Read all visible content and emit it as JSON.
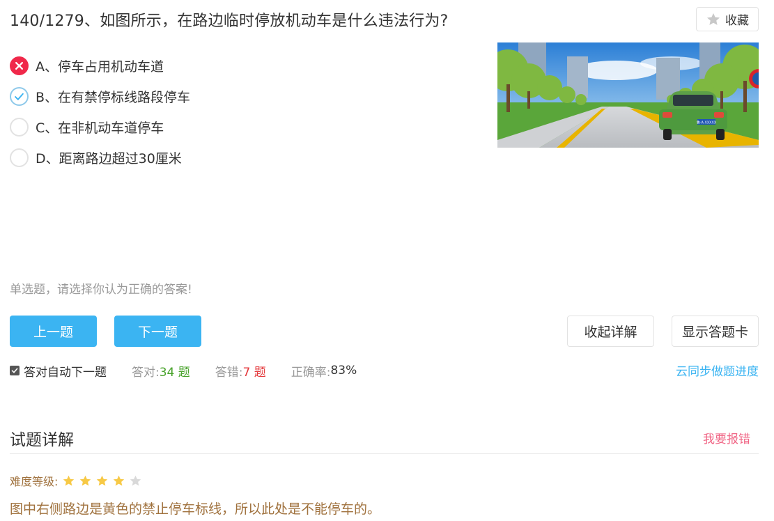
{
  "question": {
    "title": "140/1279、如图所示，在路边临时停放机动车是什么违法行为?",
    "favorite_label": "收藏",
    "favorite_icon": "star-icon"
  },
  "options": [
    {
      "label": "A、停车占用机动车道",
      "state": "wrong"
    },
    {
      "label": "B、在有禁停标线路段停车",
      "state": "correct"
    },
    {
      "label": "C、在非机动车道停车",
      "state": "none"
    },
    {
      "label": "D、距离路边超过30厘米",
      "state": "none"
    }
  ],
  "plate_text": "鲁·A·XXXXX",
  "hint": "单选题，请选择你认为正确的答案!",
  "buttons": {
    "prev": "上一题",
    "next": "下一题",
    "collapse": "收起详解",
    "answer_card": "显示答题卡"
  },
  "stats": {
    "auto_next_label": "答对自动下一题",
    "auto_next_checked": true,
    "correct_label": "答对:",
    "correct_value": "34 题",
    "wrong_label": "答错:",
    "wrong_value": "7 题",
    "rate_label": "正确率:",
    "rate_value": "83%"
  },
  "sync_link": "云同步做题进度",
  "detail": {
    "title": "试题详解",
    "report": "我要报错",
    "difficulty_label": "难度等级:",
    "difficulty_stars": 4,
    "difficulty_max": 5,
    "explanation": "图中右侧路边是黄色的禁止停车标线，所以此处是不能停车的。"
  },
  "colors": {
    "accent_blue": "#3bb4f2",
    "wrong_red": "#f0284a",
    "correct_green": "#47a22a",
    "error_red": "#e4393c",
    "report_pink": "#f06585",
    "explain_brown": "#a0723e",
    "star_gold": "#f7c946",
    "star_gray": "#d9d9d9"
  }
}
